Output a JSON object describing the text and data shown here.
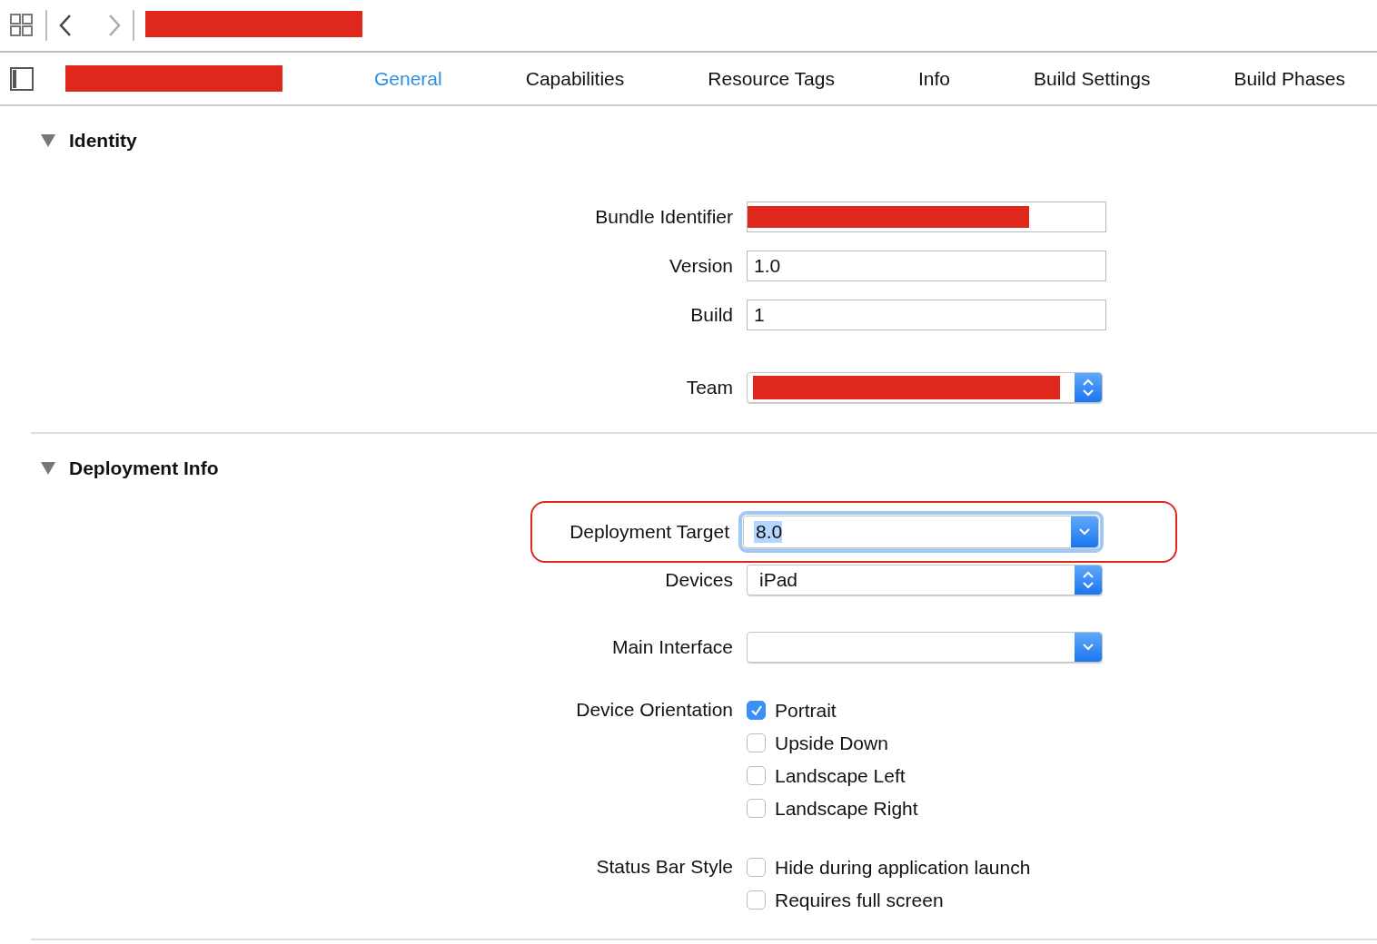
{
  "tabs": [
    {
      "label": "General",
      "selected": true
    },
    {
      "label": "Capabilities",
      "selected": false
    },
    {
      "label": "Resource Tags",
      "selected": false
    },
    {
      "label": "Info",
      "selected": false
    },
    {
      "label": "Build Settings",
      "selected": false
    },
    {
      "label": "Build Phases",
      "selected": false
    }
  ],
  "sections": [
    {
      "title": "Identity",
      "expanded": true,
      "groups": [
        [
          {
            "label": "Bundle Identifier",
            "kind": "text",
            "redacted": true
          },
          {
            "label": "Version",
            "kind": "text",
            "value": "1.0"
          },
          {
            "label": "Build",
            "kind": "text",
            "value": "1"
          }
        ],
        [
          {
            "label": "Team",
            "kind": "popup",
            "redacted": true
          }
        ]
      ]
    },
    {
      "title": "Deployment Info",
      "expanded": true,
      "groups": [
        [
          {
            "label": "Deployment Target",
            "kind": "combo",
            "value": "8.0",
            "focused": true,
            "highlighted": true
          },
          {
            "label": "Devices",
            "kind": "popup",
            "value": "iPad"
          }
        ],
        [
          {
            "label": "Main Interface",
            "kind": "combo"
          }
        ],
        [
          {
            "label": "Device Orientation",
            "kind": "checks",
            "options": [
              {
                "label": "Portrait",
                "checked": true
              },
              {
                "label": "Upside Down",
                "checked": false
              },
              {
                "label": "Landscape Left",
                "checked": false
              },
              {
                "label": "Landscape Right",
                "checked": false
              }
            ]
          }
        ],
        [
          {
            "label": "Status Bar Style",
            "kind": "checks",
            "options": [
              {
                "label": "Hide during application launch",
                "checked": false
              },
              {
                "label": "Requires full screen",
                "checked": false
              }
            ]
          }
        ]
      ]
    }
  ]
}
